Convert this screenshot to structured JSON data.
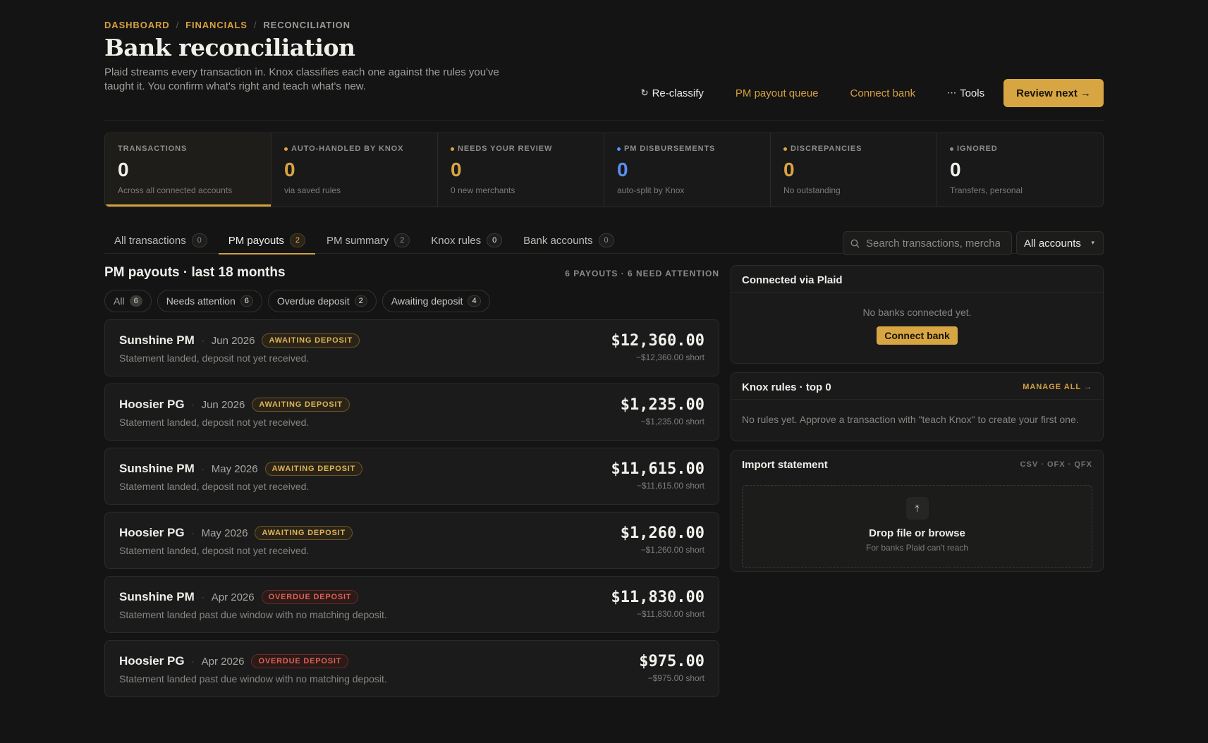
{
  "breadcrumb": [
    "DASHBOARD",
    "FINANCIALS",
    "RECONCILIATION"
  ],
  "header": {
    "title": "Bank reconciliation",
    "subtitle": "Plaid streams every transaction in. Knox classifies each one against the rules you've taught it. You confirm what's right and teach what's new."
  },
  "actions": {
    "reclassify": "Re-classify",
    "pm_payout_queue": "PM payout queue",
    "connect_bank": "Connect bank",
    "tools": "Tools",
    "review_next": "Review next →"
  },
  "stats": [
    {
      "label": "TRANSACTIONS",
      "value": "0",
      "sub": "Across all connected accounts",
      "color": "#f1efe9",
      "dot": ""
    },
    {
      "label": "AUTO-HANDLED BY KNOX",
      "value": "0",
      "sub": "via saved rules",
      "color": "#d9a442",
      "dot": "#d9a442"
    },
    {
      "label": "NEEDS YOUR REVIEW",
      "value": "0",
      "sub": "0 new merchants",
      "color": "#d9a442",
      "dot": "#d9a442"
    },
    {
      "label": "PM DISBURSEMENTS",
      "value": "0",
      "sub": "auto-split by Knox",
      "color": "#5a8ef0",
      "dot": "#5a8ef0"
    },
    {
      "label": "DISCREPANCIES",
      "value": "0",
      "sub": "No outstanding",
      "color": "#d9a442",
      "dot": "#d9a442"
    },
    {
      "label": "IGNORED",
      "value": "0",
      "sub": "Transfers, personal",
      "color": "#f1efe9",
      "dot": "#8c8a86"
    }
  ],
  "tabs": [
    {
      "label": "All transactions",
      "count": "0"
    },
    {
      "label": "PM payouts",
      "count": "2"
    },
    {
      "label": "PM summary",
      "count": "2"
    },
    {
      "label": "Knox rules",
      "count": "0"
    },
    {
      "label": "Bank accounts",
      "count": "0"
    }
  ],
  "search": {
    "placeholder": "Search transactions, merchants"
  },
  "account_filter": {
    "selected": "All accounts"
  },
  "payouts_section": {
    "title": "PM payouts · last 18 months",
    "meta": "6 PAYOUTS · 6 NEED ATTENTION",
    "chips": [
      {
        "label": "All",
        "count": "6"
      },
      {
        "label": "Needs attention",
        "count": "6"
      },
      {
        "label": "Overdue deposit",
        "count": "2"
      },
      {
        "label": "Awaiting deposit",
        "count": "4"
      }
    ],
    "items": [
      {
        "payee": "Sunshine PM",
        "period": "Jun 2026",
        "status": "AWAITING DEPOSIT",
        "status_type": "awaiting",
        "desc": "Statement landed, deposit not yet received.",
        "amount": "$12,360.00",
        "short": "−$12,360.00 short"
      },
      {
        "payee": "Hoosier PG",
        "period": "Jun 2026",
        "status": "AWAITING DEPOSIT",
        "status_type": "awaiting",
        "desc": "Statement landed, deposit not yet received.",
        "amount": "$1,235.00",
        "short": "−$1,235.00 short"
      },
      {
        "payee": "Sunshine PM",
        "period": "May 2026",
        "status": "AWAITING DEPOSIT",
        "status_type": "awaiting",
        "desc": "Statement landed, deposit not yet received.",
        "amount": "$11,615.00",
        "short": "−$11,615.00 short"
      },
      {
        "payee": "Hoosier PG",
        "period": "May 2026",
        "status": "AWAITING DEPOSIT",
        "status_type": "awaiting",
        "desc": "Statement landed, deposit not yet received.",
        "amount": "$1,260.00",
        "short": "−$1,260.00 short"
      },
      {
        "payee": "Sunshine PM",
        "period": "Apr 2026",
        "status": "OVERDUE DEPOSIT",
        "status_type": "overdue",
        "desc": "Statement landed past due window with no matching deposit.",
        "amount": "$11,830.00",
        "short": "−$11,830.00 short"
      },
      {
        "payee": "Hoosier PG",
        "period": "Apr 2026",
        "status": "OVERDUE DEPOSIT",
        "status_type": "overdue",
        "desc": "Statement landed past due window with no matching deposit.",
        "amount": "$975.00",
        "short": "−$975.00 short"
      }
    ]
  },
  "plaid_card": {
    "title": "Connected via Plaid",
    "empty": "No banks connected yet.",
    "button": "Connect bank"
  },
  "rules_card": {
    "title": "Knox rules · top 0",
    "link": "MANAGE ALL →",
    "empty": "No rules yet. Approve a transaction with \"teach Knox\" to create your first one."
  },
  "import_card": {
    "title": "Import statement",
    "formats": "CSV · OFX · QFX",
    "drop_title": "Drop file or browse",
    "drop_sub": "For banks Plaid can't reach"
  }
}
